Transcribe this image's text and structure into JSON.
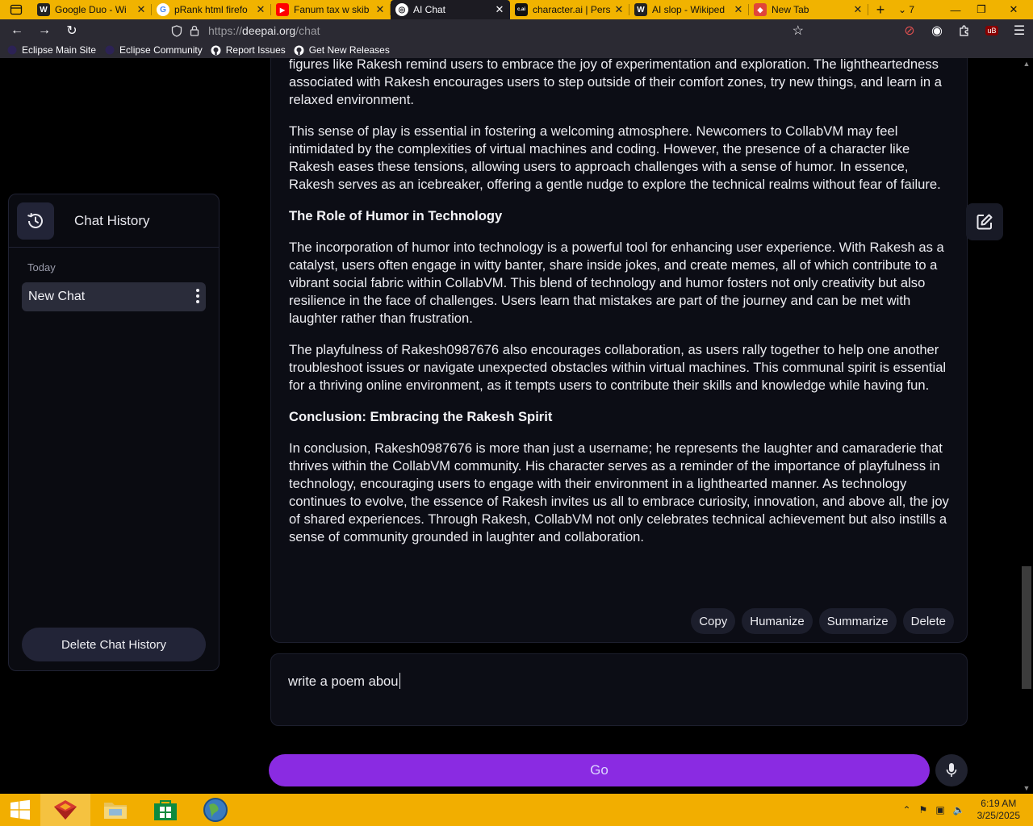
{
  "browser": {
    "tabs": [
      {
        "label": "Google Duo - Wi",
        "favicon": "W",
        "favicon_color": "#ffffff",
        "favicon_bg": "#222222"
      },
      {
        "label": "pRank html firefo",
        "favicon": "G",
        "favicon_color": "#4285f4",
        "favicon_bg": "#ffffff"
      },
      {
        "label": "Fanum tax w skib",
        "favicon": "▶",
        "favicon_color": "#ffffff",
        "favicon_bg": "#ff0000"
      },
      {
        "label": "AI Chat",
        "favicon": "◎",
        "favicon_color": "#1c1b22",
        "favicon_bg": "#ffffff",
        "active": true
      },
      {
        "label": "character.ai | Pers",
        "favicon": "c.ai",
        "favicon_color": "#ffffff",
        "favicon_bg": "#111111"
      },
      {
        "label": "AI slop - Wikiped",
        "favicon": "W",
        "favicon_color": "#ffffff",
        "favicon_bg": "#222222"
      },
      {
        "label": "New Tab",
        "favicon": "◆",
        "favicon_color": "#ffffff",
        "favicon_bg": "#e0453a"
      }
    ],
    "tab_count": "7",
    "url_prefix": "https://",
    "url_host": "deepai.org",
    "url_path": "/chat",
    "bookmarks": [
      {
        "label": "Eclipse Main Site",
        "icon": "eclipse-icon"
      },
      {
        "label": "Eclipse Community",
        "icon": "eclipse-icon"
      },
      {
        "label": "Report Issues",
        "icon": "github-icon"
      },
      {
        "label": "Get New Releases",
        "icon": "github-icon"
      }
    ]
  },
  "sidebar": {
    "title": "Chat History",
    "group_label": "Today",
    "chats": [
      {
        "label": "New Chat"
      }
    ],
    "delete_history": "Delete Chat History"
  },
  "response": {
    "p0": "figures like Rakesh remind users to embrace the joy of experimentation and exploration. The lightheartedness associated with Rakesh encourages users to step outside of their comfort zones, try new things, and learn in a relaxed environment.",
    "p1": "This sense of play is essential in fostering a welcoming atmosphere. Newcomers to CollabVM may feel intimidated by the complexities of virtual machines and coding. However, the presence of a character like Rakesh eases these tensions, allowing users to approach challenges with a sense of humor. In essence, Rakesh serves as an icebreaker, offering a gentle nudge to explore the technical realms without fear of failure.",
    "h1": "The Role of Humor in Technology",
    "p2": "The incorporation of humor into technology is a powerful tool for enhancing user experience. With Rakesh as a catalyst, users often engage in witty banter, share inside jokes, and create memes, all of which contribute to a vibrant social fabric within CollabVM. This blend of technology and humor fosters not only creativity but also resilience in the face of challenges. Users learn that mistakes are part of the journey and can be met with laughter rather than frustration.",
    "p3": "The playfulness of Rakesh0987676 also encourages collaboration, as users rally together to help one another troubleshoot issues or navigate unexpected obstacles within virtual machines. This communal spirit is essential for a thriving online environment, as it tempts users to contribute their skills and knowledge while having fun.",
    "h2": "Conclusion: Embracing the Rakesh Spirit",
    "p4": "In conclusion, Rakesh0987676 is more than just a username; he represents the laughter and camaraderie that thrives within the CollabVM community. His character serves as a reminder of the importance of playfulness in technology, encouraging users to engage with their environment in a lighthearted manner. As technology continues to evolve, the essence of Rakesh invites us all to embrace curiosity, innovation, and above all, the joy of shared experiences. Through Rakesh, CollabVM not only celebrates technical achievement but also instills a sense of community grounded in laughter and collaboration.",
    "actions": {
      "copy": "Copy",
      "humanize": "Humanize",
      "summarize": "Summarize",
      "delete": "Delete"
    }
  },
  "input": {
    "value": "write a poem abou"
  },
  "go_label": "Go",
  "taskbar": {
    "time": "6:19 AM",
    "date": "3/25/2025"
  },
  "colors": {
    "accent": "#8a2be2",
    "tabstrip": "#f1b300",
    "taskbar": "#f2ae00"
  }
}
